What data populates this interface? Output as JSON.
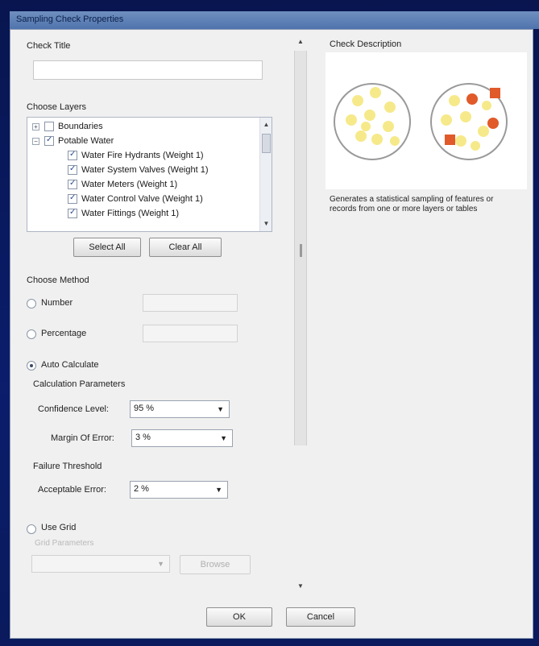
{
  "window": {
    "title": "Sampling Check Properties"
  },
  "check_title": {
    "label": "Check Title",
    "value": ""
  },
  "layers": {
    "label": "Choose Layers",
    "items": [
      {
        "label": "Boundaries",
        "checked": false,
        "expander": "+"
      },
      {
        "label": "Potable Water",
        "checked": true,
        "expander": "−"
      },
      {
        "label": "Water Fire Hydrants (Weight 1)",
        "checked": true
      },
      {
        "label": "Water System Valves (Weight 1)",
        "checked": true
      },
      {
        "label": "Water Meters (Weight 1)",
        "checked": true
      },
      {
        "label": "Water Control Valve (Weight 1)",
        "checked": true
      },
      {
        "label": "Water Fittings (Weight 1)",
        "checked": true
      }
    ],
    "select_all": "Select All",
    "clear_all": "Clear All"
  },
  "method": {
    "label": "Choose Method",
    "number": {
      "label": "Number",
      "selected": false,
      "value": ""
    },
    "percentage": {
      "label": "Percentage",
      "selected": false,
      "value": ""
    },
    "auto": {
      "label": "Auto Calculate",
      "selected": true
    },
    "calc_params": {
      "label": "Calculation Parameters",
      "confidence_label": "Confidence Level:",
      "confidence_value": "95 %",
      "margin_label": "Margin Of Error:",
      "margin_value": "3 %"
    },
    "failure": {
      "label": "Failure Threshold",
      "acceptable_label": "Acceptable Error:",
      "acceptable_value": "2 %"
    },
    "use_grid": {
      "label": "Use Grid",
      "selected": false
    },
    "grid_params_label": "Grid Parameters",
    "grid_combo_value": "",
    "browse_button": "Browse"
  },
  "description": {
    "label": "Check Description",
    "text": "Generates a statistical sampling of features or records from one or more layers or tables"
  },
  "buttons": {
    "ok": "OK",
    "cancel": "Cancel"
  },
  "colors": {
    "title_bar": "#4f74ad",
    "background": "#0a1a5c",
    "dialog": "#f0f0f0",
    "sample_light": "#f6e98a",
    "sample_selected": "#e05a2a"
  }
}
